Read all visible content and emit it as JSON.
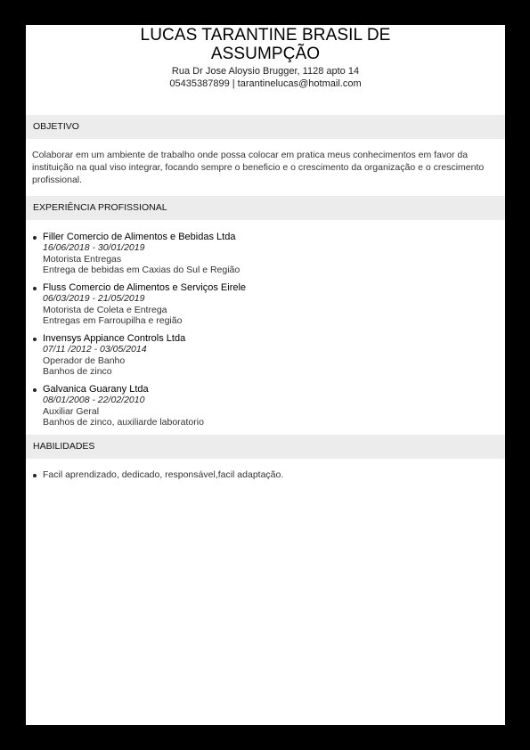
{
  "header": {
    "name": "LUCAS TARANTINE BRASIL DE ASSUMPÇÃO",
    "address": "Rua Dr Jose Aloysio Brugger, 1128 apto 14",
    "contact": "05435387899 | tarantinelucas@hotmail.com"
  },
  "objective": {
    "title": "OBJETIVO",
    "text": "Colaborar em um ambiente de trabalho onde possa colocar em pratica meus conhecimentos em favor da instituição na qual viso integrar, focando sempre o beneficio e o crescimento da organização e o crescimento profissional."
  },
  "experience": {
    "title": "EXPERIÊNCIA PROFISSIONAL",
    "jobs": [
      {
        "company": "Filler Comercio de Alimentos e Bebidas Ltda",
        "dates": "16/06/2018 - 30/01/2019",
        "role": "Motorista Entregas",
        "description": "Entrega de bebidas em Caxias do Sul e Região"
      },
      {
        "company": "Fluss Comercio de Alimentos e Serviços Eirele",
        "dates": "06/03/2019 - 21/05/2019",
        "role": "Motorista de Coleta e Entrega",
        "description": "Entregas em Farroupilha e região"
      },
      {
        "company": "Invensys Appiance Controls Ltda",
        "dates": "07/11 /2012 - 03/05/2014",
        "role": "Operador de Banho",
        "description": "Banhos de zinco"
      },
      {
        "company": "Galvanica Guarany Ltda",
        "dates": "08/01/2008 - 22/02/2010",
        "role": "Auxiliar Geral",
        "description": "Banhos de zinco, auxiliarde laboratorio"
      }
    ]
  },
  "skills": {
    "title": "HABILIDADES",
    "items": [
      "Facil aprendizado, dedicado, responsável,facil adaptação."
    ]
  }
}
